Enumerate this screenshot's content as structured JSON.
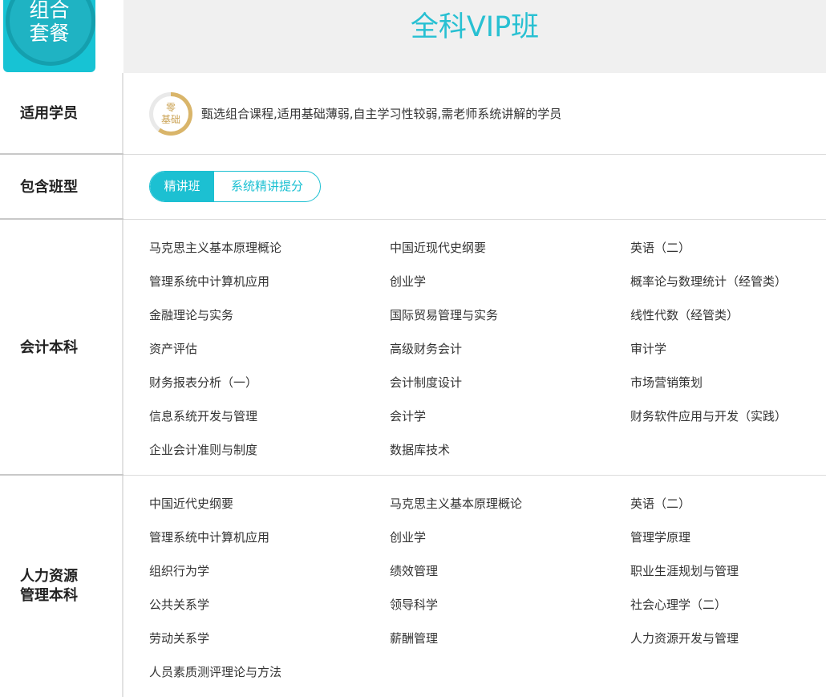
{
  "header": {
    "badge_line1": "组合",
    "badge_line2": "套餐",
    "title": "全科VIP班"
  },
  "students": {
    "label": "适用学员",
    "badge_line1": "零",
    "badge_line2": "基础",
    "description": "甄选组合课程,适用基础薄弱,自主学习性较弱,需老师系统讲解的学员"
  },
  "class_types": {
    "label": "包含班型",
    "options": [
      "精讲班",
      "系统精讲提分"
    ]
  },
  "sections": [
    {
      "label": "会计本科",
      "courses": [
        [
          "马克思主义基本原理概论",
          "中国近现代史纲要",
          "英语（二）"
        ],
        [
          "管理系统中计算机应用",
          "创业学",
          "概率论与数理统计（经管类）"
        ],
        [
          "金融理论与实务",
          "国际贸易管理与实务",
          "线性代数（经管类）"
        ],
        [
          "资产评估",
          "高级财务会计",
          "审计学"
        ],
        [
          "财务报表分析（一）",
          "会计制度设计",
          "市场营销策划"
        ],
        [
          "信息系统开发与管理",
          "会计学",
          "财务软件应用与开发（实践）"
        ],
        [
          "企业会计准则与制度",
          "数据库技术",
          ""
        ]
      ]
    },
    {
      "label_line1": "人力资源",
      "label_line2": "管理本科",
      "courses": [
        [
          "中国近代史纲要",
          "马克思主义基本原理概论",
          "英语（二）"
        ],
        [
          "管理系统中计算机应用",
          "创业学",
          "管理学原理"
        ],
        [
          "组织行为学",
          "绩效管理",
          "职业生涯规划与管理"
        ],
        [
          "公共关系学",
          "领导科学",
          "社会心理学（二）"
        ],
        [
          "劳动关系学",
          "薪酬管理",
          "人力资源开发与管理"
        ],
        [
          "人员素质测评理论与方法",
          "",
          ""
        ]
      ]
    }
  ]
}
